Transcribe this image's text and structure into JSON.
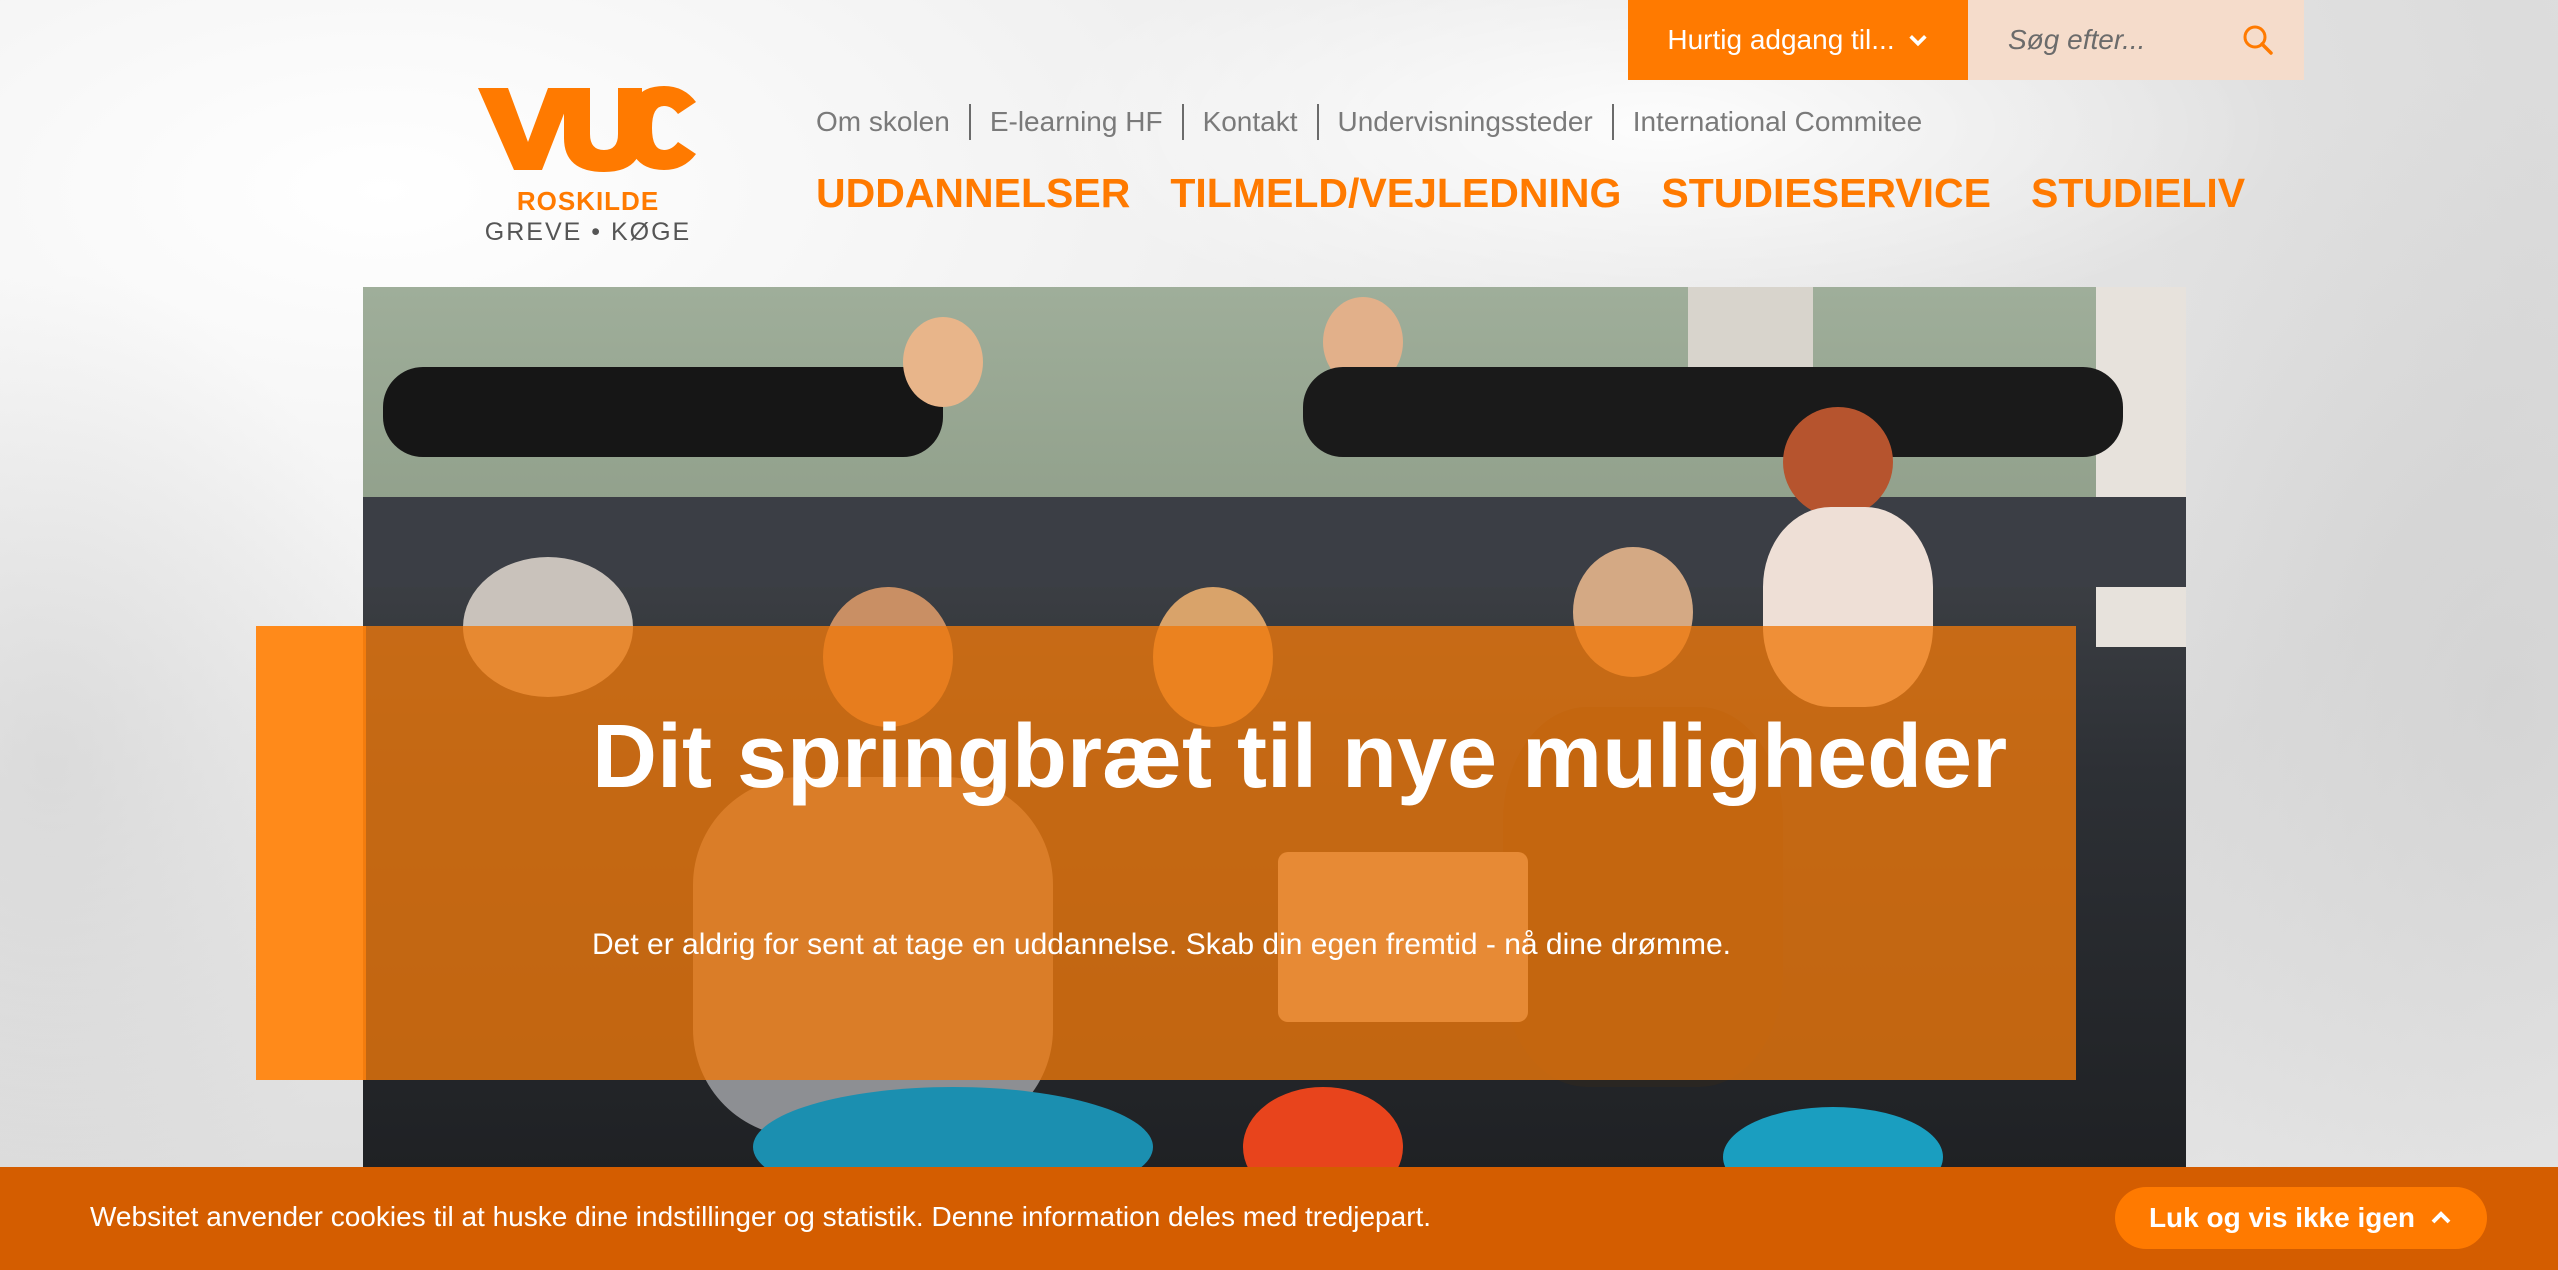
{
  "header": {
    "quick_access_label": "Hurtig adgang til...",
    "search_placeholder": "Søg efter...",
    "logo": {
      "mark_text": "VUC",
      "name": "ROSKILDE",
      "locations": "GREVE • KØGE"
    },
    "utility_nav": [
      "Om skolen",
      "E-learning HF",
      "Kontakt",
      "Undervisningssteder",
      "International Commitee"
    ],
    "main_nav": [
      "UDDANNELSER",
      "TILMELD/VEJLEDNING",
      "STUDIESERVICE",
      "STUDIELIV"
    ]
  },
  "hero": {
    "title": "Dit springbræt til nye muligheder",
    "subtitle": "Det er aldrig for sent at tage en uddannelse. Skab din egen fremtid - nå dine drømme."
  },
  "cookie": {
    "text": "Websitet anvender cookies til at huske dine indstillinger og statistik. Denne information deles med tredjepart.",
    "button_label": "Luk og vis ikke igen"
  },
  "colors": {
    "brand_orange": "#ff7a00",
    "cookie_bar": "#d45d00",
    "search_bg": "#f5dccb"
  },
  "icons": {
    "quick_access": "chevron-down-icon",
    "search": "search-icon",
    "cookie_button": "chevron-up-icon"
  }
}
